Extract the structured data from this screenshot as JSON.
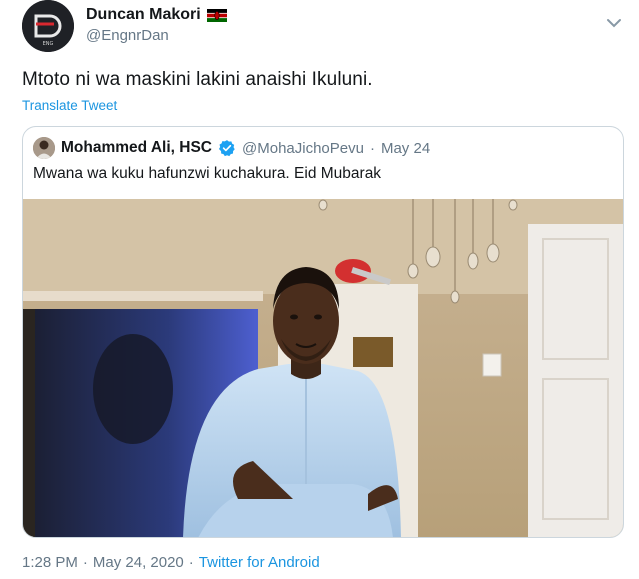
{
  "author": {
    "display_name": "Duncan Makori",
    "handle": "@EngnrDan",
    "flag_icon": "kenya-flag-icon",
    "avatar_text": "ENG"
  },
  "tweet": {
    "text": "Mtoto ni wa maskini lakini anaishi Ikuluni.",
    "translate_label": "Translate Tweet"
  },
  "quoted": {
    "display_name": "Mohammed Ali, HSC",
    "verified_icon": "verified-badge-icon",
    "handle": "@MohaJichoPevu",
    "separator": "·",
    "date": "May 24",
    "text": "Mwana wa kuku hafunzwi kuchakura. Eid Mubarak"
  },
  "meta": {
    "time": "1:28 PM",
    "sep1": "·",
    "date": "May 24, 2020",
    "sep2": "·",
    "source": "Twitter for Android"
  },
  "colors": {
    "link": "#1b95e0",
    "secondary": "#657786",
    "border": "#ccd6dd",
    "text": "#14171a"
  }
}
